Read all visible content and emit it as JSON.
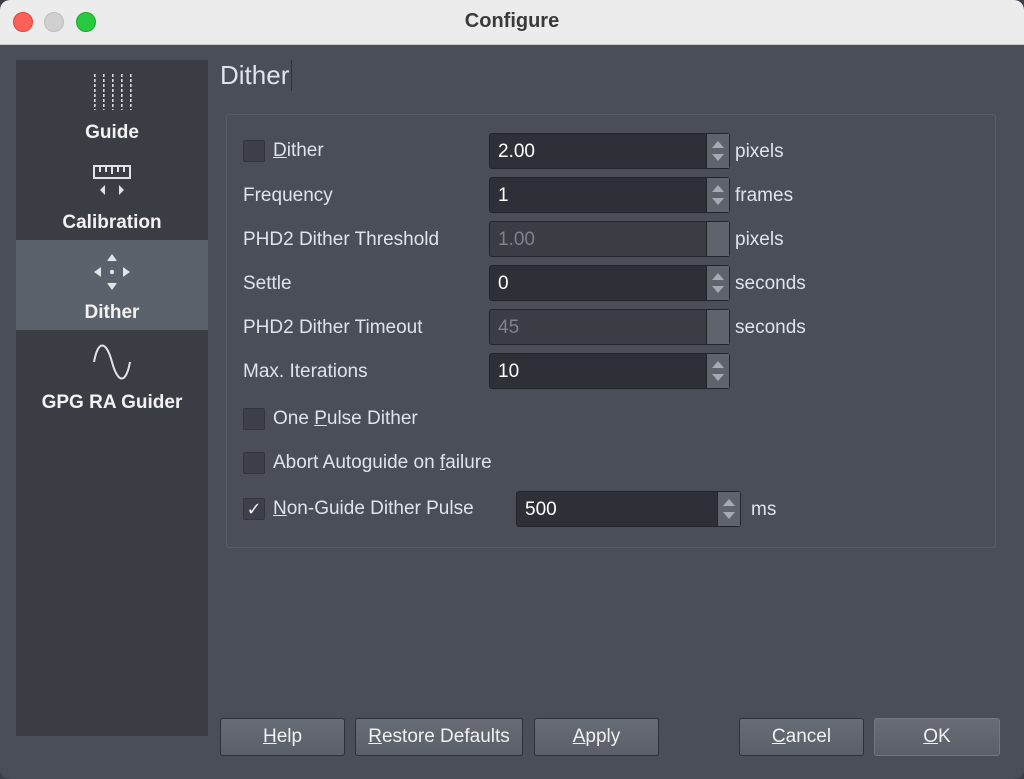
{
  "window": {
    "title": "Configure"
  },
  "sidebar": {
    "items": [
      {
        "label": "Guide",
        "icon": "dots-grid-icon",
        "selected": false
      },
      {
        "label": "Calibration",
        "icon": "ruler-icon",
        "selected": false
      },
      {
        "label": "Dither",
        "icon": "move-arrows-icon",
        "selected": true
      },
      {
        "label": "GPG RA Guider",
        "icon": "sine-wave-icon",
        "selected": false
      }
    ]
  },
  "page": {
    "title": "Dither"
  },
  "form": {
    "dither": {
      "label_pre": "",
      "label_mn": "D",
      "label_post": "ither",
      "checked": false,
      "value": "2.00",
      "unit": "pixels"
    },
    "frequency": {
      "label": "Frequency",
      "value": "1",
      "unit": "frames"
    },
    "threshold": {
      "label": "PHD2 Dither Threshold",
      "value": "1.00",
      "unit": "pixels",
      "disabled": true
    },
    "settle": {
      "label": "Settle",
      "value": "0",
      "unit": "seconds"
    },
    "timeout": {
      "label": "PHD2 Dither Timeout",
      "value": "45",
      "unit": "seconds",
      "disabled": true
    },
    "max_iterations": {
      "label": "Max. Iterations",
      "value": "10"
    },
    "one_pulse": {
      "label_pre": "One ",
      "label_mn": "P",
      "label_post": "ulse Dither",
      "checked": false
    },
    "abort_autoguide": {
      "label_pre": "Abort Autoguide on ",
      "label_mn": "f",
      "label_post": "ailure",
      "checked": false
    },
    "non_guide": {
      "label_pre": "",
      "label_mn": "N",
      "label_post": "on-Guide Dither Pulse",
      "checked": true,
      "check_glyph": "✓",
      "value": "500",
      "unit": "ms"
    }
  },
  "buttons": {
    "help": {
      "pre": "",
      "mn": "H",
      "post": "elp"
    },
    "restore": {
      "pre": "",
      "mn": "R",
      "post": "estore Defaults"
    },
    "apply": {
      "pre": "",
      "mn": "A",
      "post": "pply"
    },
    "cancel": {
      "pre": "",
      "mn": "C",
      "post": "ancel"
    },
    "ok": {
      "pre": "",
      "mn": "O",
      "post": "K"
    }
  },
  "colors": {
    "background": "#4a4e57",
    "sidebar": "#3a3d44",
    "selected": "#5b626c",
    "close": "#fe5f57",
    "maximize": "#28c840"
  }
}
